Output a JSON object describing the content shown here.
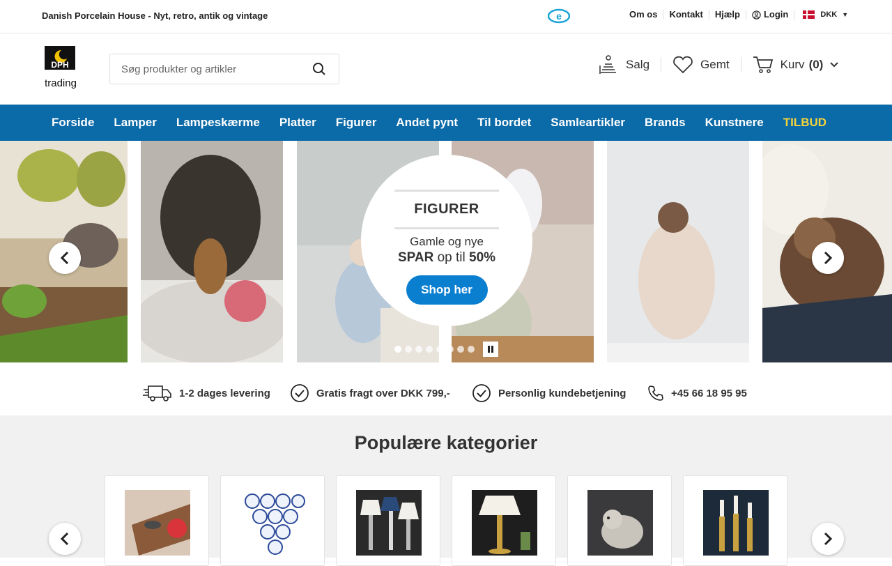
{
  "topbar": {
    "tagline": "Danish Porcelain House - Nyt, retro, antik og vintage",
    "links": [
      "Om os",
      "Kontakt",
      "Hjælp",
      "Login"
    ],
    "currency": "DKK"
  },
  "header": {
    "logo_text_top": "DPH",
    "logo_text_bottom": "trading",
    "search_placeholder": "Søg produkter og artikler",
    "sell_label": "Salg",
    "saved_label": "Gemt",
    "cart_label": "Kurv",
    "cart_count": "(0)"
  },
  "nav": {
    "items": [
      "Forside",
      "Lamper",
      "Lampeskærme",
      "Platter",
      "Figurer",
      "Andet pynt",
      "Til bordet",
      "Samleartikler",
      "Brands",
      "Kunstnere"
    ],
    "offer": "TILBUD",
    "offer_color": "#f5d33a",
    "bg_color": "#0b6aa8"
  },
  "hero": {
    "title": "FIGURER",
    "subtitle": "Gamle og nye",
    "save_word": "SPAR",
    "save_mid": "op til",
    "save_pct": "50%",
    "button": "Shop her",
    "slide_count": 8,
    "active_slide": 1
  },
  "usps": {
    "delivery": "1-2 dages levering",
    "freight": "Gratis fragt over DKK 799,-",
    "service": "Personlig kundebetjening",
    "phone": "+45 66 18 95 95"
  },
  "categories": {
    "heading": "Populære kategorier"
  }
}
